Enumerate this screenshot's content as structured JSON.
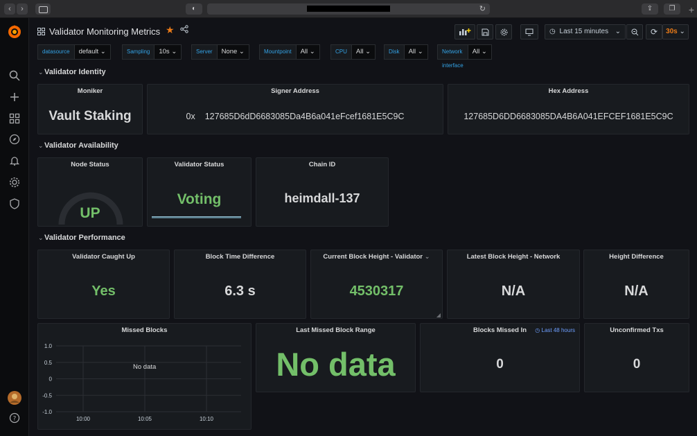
{
  "browser": {
    "back_icon": "chevron-left-icon",
    "forward_icon": "chevron-right-icon",
    "new_tab": "+"
  },
  "dashboard": {
    "title": "Validator Monitoring Metrics",
    "time_range": "Last 15 minutes",
    "refresh_interval": "30s",
    "accent": "#eb7b18"
  },
  "variables": [
    {
      "label": "datasource",
      "value": "default"
    },
    {
      "label": "Sampling",
      "value": "10s"
    },
    {
      "label": "Server",
      "value": "None"
    },
    {
      "label": "Mountpoint",
      "value": "All"
    },
    {
      "label": "CPU",
      "value": "All"
    },
    {
      "label": "Disk",
      "value": "All"
    },
    {
      "label": "Network interface",
      "value": "All"
    }
  ],
  "rows": {
    "identity": "Validator Identity",
    "availability": "Validator Availability",
    "performance": "Validator Performance"
  },
  "panels": {
    "moniker": {
      "title": "Moniker",
      "value": "Vault Staking"
    },
    "signer": {
      "title": "Signer Address",
      "prefix": "0x",
      "value": "127685D6dD6683085Da4B6a041eFcef1681E5C9C"
    },
    "hex": {
      "title": "Hex Address",
      "value": "127685D6DD6683085DA4B6A041EFCEF1681E5C9C"
    },
    "node_status": {
      "title": "Node Status",
      "value": "UP"
    },
    "validator_status": {
      "title": "Validator Status",
      "value": "Voting"
    },
    "chain_id": {
      "title": "Chain ID",
      "value": "heimdall-137"
    },
    "caught_up": {
      "title": "Validator Caught Up",
      "value": "Yes"
    },
    "block_time": {
      "title": "Block Time Difference",
      "value": "6.3 s"
    },
    "current_height": {
      "title": "Current Block Height - Validator",
      "value": "4530317"
    },
    "latest_height": {
      "title": "Latest Block Height - Network",
      "value": "N/A"
    },
    "height_diff": {
      "title": "Height Difference",
      "value": "N/A"
    },
    "missed_blocks": {
      "title": "Missed Blocks",
      "no_data": "No data"
    },
    "last_missed": {
      "title": "Last Missed Block Range",
      "value": "No data"
    },
    "blocks_missed_in": {
      "title": "Blocks Missed In",
      "time_link": "Last 48 hours",
      "value": "0"
    },
    "unconfirmed": {
      "title": "Unconfirmed Txs",
      "value": "0"
    }
  },
  "chart_data": {
    "type": "line",
    "title": "Missed Blocks",
    "y_ticks": [
      "1.0",
      "0.5",
      "0",
      "-0.5",
      "-1.0"
    ],
    "x_ticks": [
      "10:00",
      "10:05",
      "10:10"
    ],
    "ylim": [
      -1.0,
      1.0
    ],
    "series": [],
    "grid": true
  }
}
